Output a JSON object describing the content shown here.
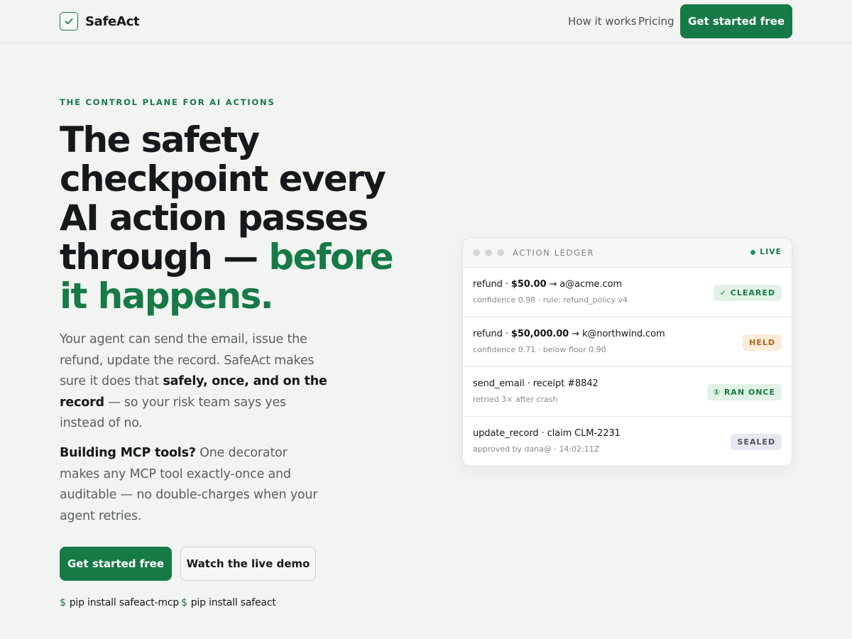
{
  "header": {
    "logo_text": "SafeAct",
    "nav": [
      {
        "label": "How it works"
      },
      {
        "label": "Pricing"
      }
    ],
    "cta_label": "Get started free"
  },
  "hero": {
    "eyebrow": "THE CONTROL PLANE FOR AI ACTIONS",
    "headline_part1": "The safety checkpoint every AI action passes through — ",
    "headline_accent": "before it happens.",
    "lede_part1": "Your agent can send the email, issue the refund, update the record. SafeAct makes sure it does that ",
    "lede_bold": "safely, once, and on the record",
    "lede_part2": " — so your risk team says yes instead of no.",
    "mcp_bold": "Building MCP tools?",
    "mcp_text": " One decorator makes any MCP tool exactly-once and auditable — no double-charges when your agent retries.",
    "primary_cta": "Get started free",
    "secondary_cta": "Watch the live demo",
    "pip_prompt": "$",
    "pip_commands": [
      "pip install safeact-mcp",
      "pip install safeact"
    ]
  },
  "ledger": {
    "title": "ACTION LEDGER",
    "live_label": "LIVE",
    "rows": [
      {
        "pre": "refund · ",
        "bold": "$50.00",
        "post": " → a@acme.com",
        "sub": "confidence 0.98 · rule: refund_policy v4",
        "badge": "✓ CLEARED",
        "status": "cleared"
      },
      {
        "pre": "refund · ",
        "bold": "$50,000.00",
        "post": " → k@northwind.com",
        "sub": "confidence 0.71 · below floor 0.90",
        "badge": "HELD",
        "status": "held"
      },
      {
        "pre": "send_email · receipt #8842",
        "bold": "",
        "post": "",
        "sub": "retried 3× after crash",
        "badge": "① RAN ONCE",
        "status": "ran-once"
      },
      {
        "pre": "update_record · claim CLM-2231",
        "bold": "",
        "post": "",
        "sub": "approved by dana@ · 14:02:11Z",
        "badge": "SEALED",
        "status": "sealed"
      }
    ]
  },
  "colors": {
    "brand": "#167a47",
    "background": "#f2f4f1",
    "held": "#b3641c",
    "sealed": "#4b5563"
  }
}
